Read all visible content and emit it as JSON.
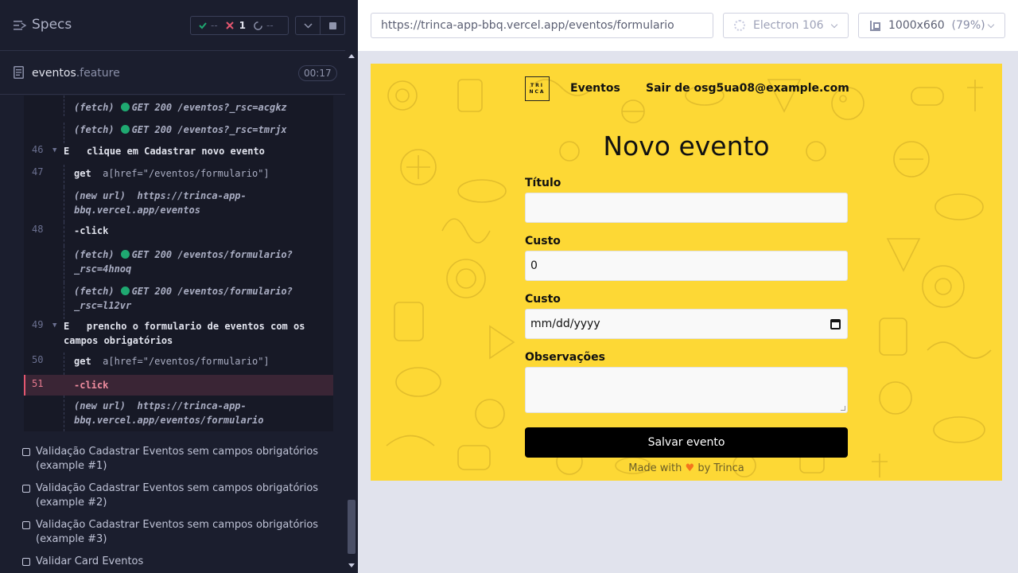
{
  "reporter": {
    "specs_title": "Specs",
    "stats": {
      "passed": "--",
      "failed": "1",
      "pending": "--"
    },
    "file": {
      "name": "eventos",
      "ext": ".feature",
      "duration": "00:17"
    },
    "commands": [
      {
        "id": "c0",
        "line": "",
        "type": "fetch",
        "prefix": "(fetch)",
        "text": "GET 200 /eventos?_rsc=acgkz"
      },
      {
        "id": "c1",
        "line": "",
        "type": "fetch",
        "prefix": "(fetch)",
        "text": "GET 200 /eventos?_rsc=tmrjx"
      },
      {
        "id": "c2",
        "line": "46",
        "type": "step",
        "keyword": "E",
        "text": "clique em Cadastrar novo evento"
      },
      {
        "id": "c3",
        "line": "47",
        "type": "cmd",
        "name": "get",
        "arg": "a[href=\"/eventos/formulario\"]"
      },
      {
        "id": "c4",
        "line": "",
        "type": "url",
        "prefix": "(new url)",
        "text": "https://trinca-app-",
        "text2": "bbq.vercel.app/eventos"
      },
      {
        "id": "c5",
        "line": "48",
        "type": "cmd",
        "name": "-click",
        "arg": ""
      },
      {
        "id": "c6",
        "line": "",
        "type": "fetch2",
        "prefix": "(fetch)",
        "text": "GET 200 /eventos/formulario?",
        "text2": "_rsc=4hnoq"
      },
      {
        "id": "c7",
        "line": "",
        "type": "fetch2",
        "prefix": "(fetch)",
        "text": "GET 200 /eventos/formulario?",
        "text2": "_rsc=l12vr"
      },
      {
        "id": "c8",
        "line": "49",
        "type": "step",
        "keyword": "E",
        "text": "prencho o formulario de eventos com os",
        "text2": "campos obrigatórios"
      },
      {
        "id": "c9",
        "line": "50",
        "type": "cmd",
        "name": "get",
        "arg": "a[href=\"/eventos/formulario\"]"
      },
      {
        "id": "c10",
        "line": "51",
        "type": "cmd",
        "name": "-click",
        "arg": ""
      },
      {
        "id": "c11",
        "line": "",
        "type": "url",
        "prefix": "(new url)",
        "text": "https://trinca-app-",
        "text2": "bbq.vercel.app/eventos/formulario"
      }
    ],
    "tests": [
      {
        "line1": "Validação Cadastrar Eventos sem campos obrigatórios",
        "line2": "(example #1)"
      },
      {
        "line1": "Validação Cadastrar Eventos sem campos obrigatórios",
        "line2": "(example #2)"
      },
      {
        "line1": "Validação Cadastrar Eventos sem campos obrigatórios",
        "line2": "(example #3)"
      },
      {
        "line1": "Validar Card Eventos",
        "line2": ""
      }
    ]
  },
  "toolbar": {
    "url": "https://trinca-app-bbq.vercel.app/eventos/formulario",
    "browser": "Electron 106",
    "viewport": "1000x660",
    "scale": "(79%)"
  },
  "app": {
    "logo_text": "TRINCA",
    "nav_eventos": "Eventos",
    "nav_logout": "Sair de osg5ua08@example.com",
    "title": "Novo evento",
    "fields": {
      "titulo_label": "Título",
      "titulo_value": "",
      "custo_label": "Custo",
      "custo_value": "0",
      "data_label": "Custo",
      "data_value": "mm/dd/yyyy",
      "obs_label": "Observações",
      "obs_value": ""
    },
    "save_label": "Salvar evento",
    "footer_before": "Made with",
    "footer_heart": "♥",
    "footer_after": "by Trinca"
  },
  "colors": {
    "accent_yellow": "#fdd835",
    "pass_green": "#1fa971",
    "fail_red": "#e45770"
  }
}
